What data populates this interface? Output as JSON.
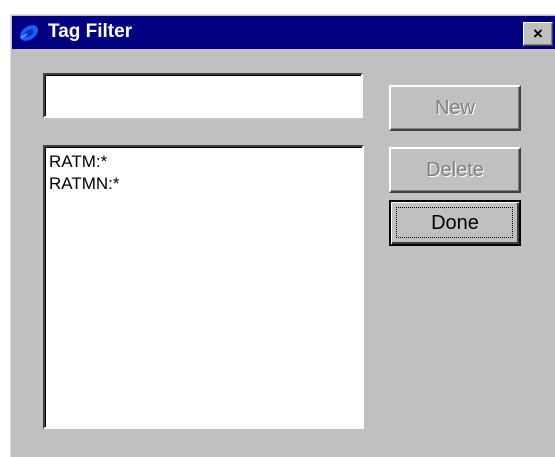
{
  "window": {
    "title": "Tag Filter",
    "close_label": "×"
  },
  "filter_input": {
    "value": "",
    "placeholder": ""
  },
  "tag_list": {
    "items": [
      {
        "label": "RATM:*"
      },
      {
        "label": "RATMN:*"
      }
    ]
  },
  "buttons": {
    "new_label": "New",
    "new_enabled": false,
    "delete_label": "Delete",
    "delete_enabled": false,
    "done_label": "Done",
    "done_enabled": true,
    "done_default": true
  },
  "colors": {
    "titlebar": "#000080",
    "face": "#c0c0c0",
    "disabled_text": "#808080"
  },
  "icons": {
    "title_icon": "app-logo-icon",
    "close_icon": "close-icon"
  }
}
